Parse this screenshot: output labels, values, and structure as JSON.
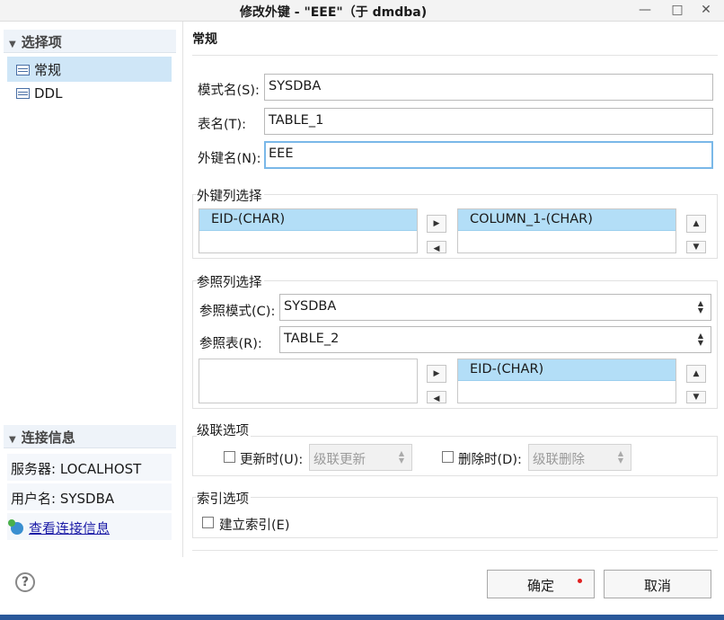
{
  "window": {
    "title": "修改外键 - \"EEE\"（于 dmdba)",
    "minimize_glyph": "—",
    "maximize_glyph": "□",
    "close_glyph": "✕"
  },
  "sidebar": {
    "section_title": "选择项",
    "items": [
      {
        "label": "常规",
        "icon": "table-icon",
        "selected": true
      },
      {
        "label": "DDL",
        "icon": "table-icon",
        "selected": false
      }
    ],
    "connection": {
      "section_title": "连接信息",
      "server": "服务器: LOCALHOST",
      "user": "用户名: SYSDBA",
      "view_link": "查看连接信息"
    }
  },
  "main": {
    "title": "常规",
    "schema_label": "模式名(S):",
    "schema_value": "SYSDBA",
    "table_label": "表名(T):",
    "table_value": "TABLE_1",
    "fk_label": "外键名(N):",
    "fk_value": "EEE",
    "fk_columns": {
      "title": "外键列选择",
      "left_items": [
        "EID-(CHAR)"
      ],
      "right_items": [
        "COLUMN_1-(CHAR)"
      ]
    },
    "ref_columns": {
      "title": "参照列选择",
      "schema_label": "参照模式(C):",
      "schema_value": "SYSDBA",
      "table_label": "参照表(R):",
      "table_value": "TABLE_2",
      "left_items": [],
      "right_items": [
        "EID-(CHAR)"
      ]
    },
    "cascade": {
      "title": "级联选项",
      "update_label": "更新时(U):",
      "update_value": "级联更新",
      "delete_label": "删除时(D):",
      "delete_value": "级联删除"
    },
    "index": {
      "title": "索引选项",
      "create_label": "建立索引(E)"
    }
  },
  "buttons": {
    "ok": "确定",
    "cancel": "取消",
    "help": "?"
  },
  "colors": {
    "selection": "#b3def7",
    "focus": "#7ab8e8",
    "link": "#1a1aa6"
  }
}
